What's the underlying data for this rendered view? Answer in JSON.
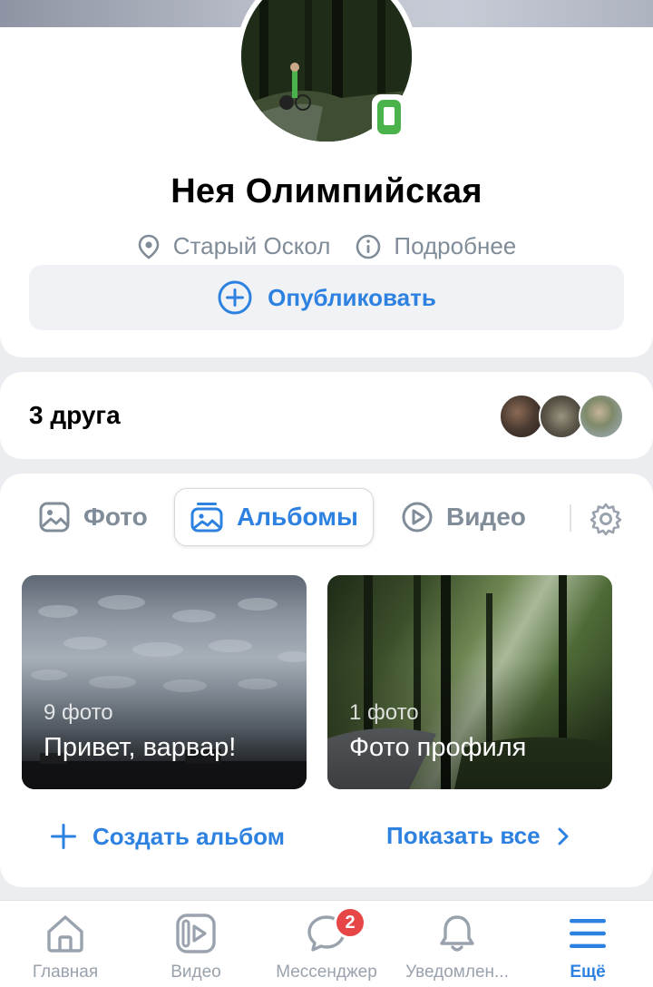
{
  "profile": {
    "name": "Нея Олимпийская",
    "city": "Старый Оскол",
    "details_link": "Подробнее",
    "publish_label": "Опубликовать"
  },
  "friends": {
    "count_label": "3 друга"
  },
  "media": {
    "tabs": [
      {
        "label": "Фото",
        "icon": "image-icon"
      },
      {
        "label": "Альбомы",
        "icon": "albums-icon",
        "active": true
      },
      {
        "label": "Видео",
        "icon": "play-circle-icon"
      }
    ],
    "albums": [
      {
        "count": "9 фото",
        "title": "Привет, варвар!"
      },
      {
        "count": "1 фото",
        "title": "Фото профиля"
      }
    ],
    "create_album_label": "Создать альбом",
    "show_all_label": "Показать все"
  },
  "tabbar": {
    "items": [
      {
        "label": "Главная",
        "icon": "home-icon"
      },
      {
        "label": "Видео",
        "icon": "video-icon"
      },
      {
        "label": "Мессенджер",
        "icon": "chat-icon",
        "badge": "2"
      },
      {
        "label": "Уведомлен...",
        "icon": "bell-icon"
      },
      {
        "label": "Ещё",
        "icon": "menu-icon",
        "active": true
      }
    ]
  },
  "colors": {
    "accent": "#2d81e0",
    "secondary_text": "#818c99",
    "online": "#4bb34b",
    "badge": "#e64646"
  }
}
